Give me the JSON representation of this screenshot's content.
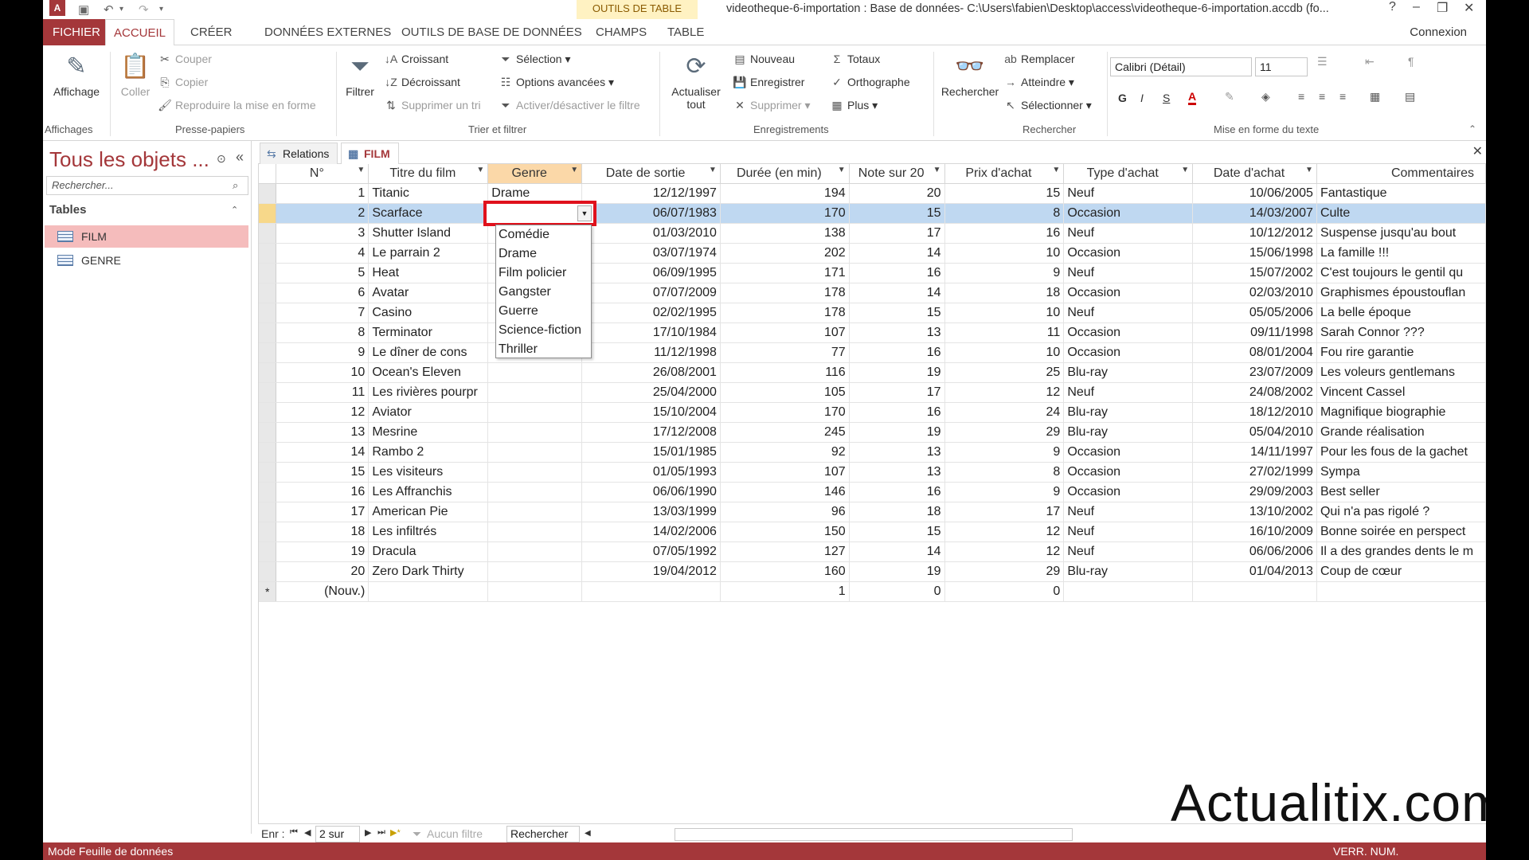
{
  "window": {
    "title": "videotheque-6-importation : Base de données- C:\\Users\\fabien\\Desktop\\access\\videotheque-6-importation.accdb (fo...",
    "context_tab_group": "OUTILS DE TABLE",
    "logo": "A"
  },
  "tabs": [
    "FICHIER",
    "ACCUEIL",
    "CRÉER",
    "DONNÉES EXTERNES",
    "OUTILS DE BASE DE DONNÉES",
    "CHAMPS",
    "TABLE"
  ],
  "connexion": "Connexion",
  "ribbon": {
    "affichages": {
      "label": "Affichages",
      "view_button": "Affichage"
    },
    "presse_papiers": {
      "label": "Presse-papiers",
      "coller": "Coller",
      "couper": "Couper",
      "copier": "Copier",
      "reproduire": "Reproduire la mise en forme"
    },
    "trier": {
      "label": "Trier et filtrer",
      "filtrer": "Filtrer",
      "croissant": "Croissant",
      "decroissant": "Décroissant",
      "supprimer_tri": "Supprimer un tri",
      "selection": "Sélection",
      "options": "Options avancées",
      "activer": "Activer/désactiver le filtre"
    },
    "enregistrements": {
      "label": "Enregistrements",
      "actualiser1": "Actualiser",
      "actualiser2": "tout",
      "nouveau": "Nouveau",
      "enregistrer": "Enregistrer",
      "supprimer": "Supprimer",
      "totaux": "Totaux",
      "orthographe": "Orthographe",
      "plus": "Plus"
    },
    "rechercher": {
      "label": "Rechercher",
      "rechercher": "Rechercher",
      "remplacer": "Remplacer",
      "atteindre": "Atteindre",
      "selectionner": "Sélectionner"
    },
    "texte": {
      "label": "Mise en forme du texte",
      "font": "Calibri (Détail)",
      "size": "11",
      "bold": "G",
      "italic": "I",
      "underline": "S"
    }
  },
  "nav": {
    "title": "Tous les objets ...",
    "search_placeholder": "Rechercher...",
    "section": "Tables",
    "items": [
      "FILM",
      "GENRE"
    ]
  },
  "doc_tabs": [
    "Relations",
    "FILM"
  ],
  "grid": {
    "columns": [
      "N°",
      "Titre du film",
      "Genre",
      "Date de sortie",
      "Durée (en min)",
      "Note sur 20",
      "Prix d'achat",
      "Type d'achat",
      "Date d'achat",
      "Commentaires"
    ],
    "rows": [
      [
        "1",
        "Titanic",
        "Drame",
        "12/12/1997",
        "194",
        "20",
        "15",
        "Neuf",
        "10/06/2005",
        "Fantastique"
      ],
      [
        "2",
        "Scarface",
        "",
        "06/07/1983",
        "170",
        "15",
        "8",
        "Occasion",
        "14/03/2007",
        "Culte"
      ],
      [
        "3",
        "Shutter Island",
        "",
        "01/03/2010",
        "138",
        "17",
        "16",
        "Neuf",
        "10/12/2012",
        "Suspense jusqu'au bout"
      ],
      [
        "4",
        "Le parrain 2",
        "",
        "03/07/1974",
        "202",
        "14",
        "10",
        "Occasion",
        "15/06/1998",
        "La famille !!!"
      ],
      [
        "5",
        "Heat",
        "",
        "06/09/1995",
        "171",
        "16",
        "9",
        "Neuf",
        "15/07/2002",
        "C'est toujours le gentil qu"
      ],
      [
        "6",
        "Avatar",
        "",
        "07/07/2009",
        "178",
        "14",
        "18",
        "Occasion",
        "02/03/2010",
        "Graphismes époustouflan"
      ],
      [
        "7",
        "Casino",
        "",
        "02/02/1995",
        "178",
        "15",
        "10",
        "Neuf",
        "05/05/2006",
        "La belle époque"
      ],
      [
        "8",
        "Terminator",
        "",
        "17/10/1984",
        "107",
        "13",
        "11",
        "Occasion",
        "09/11/1998",
        "Sarah Connor ???"
      ],
      [
        "9",
        "Le dîner de cons",
        "",
        "11/12/1998",
        "77",
        "16",
        "10",
        "Occasion",
        "08/01/2004",
        "Fou rire garantie"
      ],
      [
        "10",
        "Ocean's Eleven",
        "",
        "26/08/2001",
        "116",
        "19",
        "25",
        "Blu-ray",
        "23/07/2009",
        "Les voleurs gentlemans"
      ],
      [
        "11",
        "Les rivières pourpr",
        "",
        "25/04/2000",
        "105",
        "17",
        "12",
        "Neuf",
        "24/08/2002",
        "Vincent Cassel"
      ],
      [
        "12",
        "Aviator",
        "",
        "15/10/2004",
        "170",
        "16",
        "24",
        "Blu-ray",
        "18/12/2010",
        "Magnifique biographie"
      ],
      [
        "13",
        "Mesrine",
        "",
        "17/12/2008",
        "245",
        "19",
        "29",
        "Blu-ray",
        "05/04/2010",
        "Grande réalisation"
      ],
      [
        "14",
        "Rambo 2",
        "",
        "15/01/1985",
        "92",
        "13",
        "9",
        "Occasion",
        "14/11/1997",
        "Pour les fous de la gachet"
      ],
      [
        "15",
        "Les visiteurs",
        "",
        "01/05/1993",
        "107",
        "13",
        "8",
        "Occasion",
        "27/02/1999",
        "Sympa"
      ],
      [
        "16",
        "Les Affranchis",
        "",
        "06/06/1990",
        "146",
        "16",
        "9",
        "Occasion",
        "29/09/2003",
        "Best seller"
      ],
      [
        "17",
        "American Pie",
        "",
        "13/03/1999",
        "96",
        "18",
        "17",
        "Neuf",
        "13/10/2002",
        "Qui n'a pas rigolé ?"
      ],
      [
        "18",
        "Les infiltrés",
        "",
        "14/02/2006",
        "150",
        "15",
        "12",
        "Neuf",
        "16/10/2009",
        "Bonne soirée en perspect"
      ],
      [
        "19",
        "Dracula",
        "",
        "07/05/1992",
        "127",
        "14",
        "12",
        "Neuf",
        "06/06/2006",
        "Il a des grandes dents le m"
      ],
      [
        "20",
        "Zero Dark Thirty",
        "",
        "19/04/2012",
        "160",
        "19",
        "29",
        "Blu-ray",
        "01/04/2013",
        "Coup de cœur"
      ]
    ],
    "new_row": {
      "marker": "*",
      "id": "(Nouv.)",
      "duree": "1",
      "note": "0",
      "prix": "0"
    },
    "current_row_index": 1
  },
  "dropdown": {
    "options": [
      "Comédie",
      "Drame",
      "Film policier",
      "Gangster",
      "Guerre",
      "Science-fiction",
      "Thriller"
    ]
  },
  "record_nav": {
    "label": "Enr :",
    "position": "2 sur 20",
    "filter": "Aucun filtre",
    "search": "Rechercher"
  },
  "status": {
    "left": "Mode Feuille de données",
    "right": "VERR. NUM."
  },
  "watermark": "Actualitix.com",
  "colors": {
    "accent": "#a4373a",
    "selected_row": "#bfd8f1",
    "highlight_border": "#e0111c"
  }
}
